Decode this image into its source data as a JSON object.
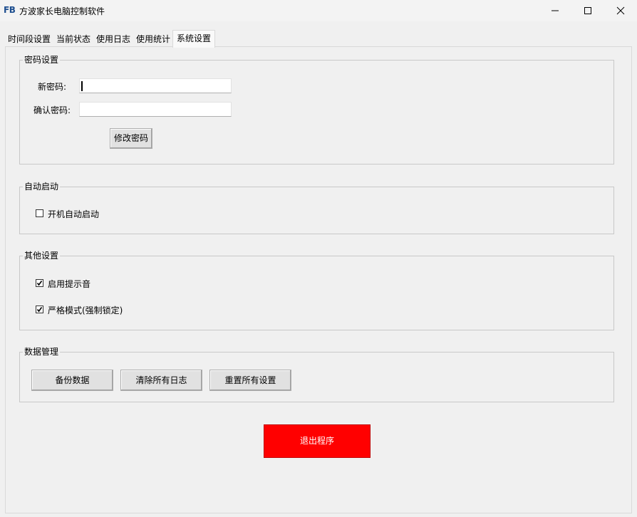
{
  "window": {
    "icon_text": "FB",
    "title": "方波家长电脑控制软件"
  },
  "tabs": [
    {
      "label": "时间段设置"
    },
    {
      "label": "当前状态"
    },
    {
      "label": "使用日志"
    },
    {
      "label": "使用统计"
    },
    {
      "label": "系统设置",
      "active": true
    }
  ],
  "password_group": {
    "title": "密码设置",
    "new_password_label": "新密码:",
    "new_password_value": "",
    "confirm_password_label": "确认密码:",
    "confirm_password_value": "",
    "change_button": "修改密码"
  },
  "autostart_group": {
    "title": "自动启动",
    "autostart_label": "开机自动启动",
    "autostart_checked": false
  },
  "other_group": {
    "title": "其他设置",
    "sound_label": "启用提示音",
    "sound_checked": true,
    "strict_label": "严格模式(强制锁定)",
    "strict_checked": true
  },
  "data_group": {
    "title": "数据管理",
    "backup_button": "备份数据",
    "clear_logs_button": "清除所有日志",
    "reset_button": "重置所有设置"
  },
  "exit_button": "退出程序",
  "colors": {
    "exit_button_bg": "#ff0000",
    "icon_color": "#1d4e8f"
  }
}
